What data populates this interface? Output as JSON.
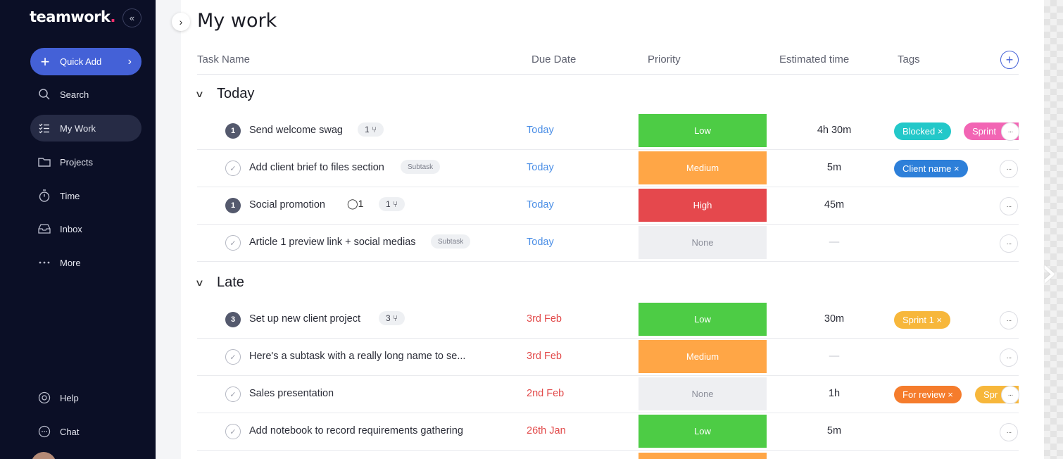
{
  "app": {
    "logo": "teamwork",
    "logo_dot": ".",
    "collapse_icon": "«"
  },
  "sidebar": {
    "quick_add": {
      "label": "Quick Add",
      "plus": "+",
      "arrow": "›"
    },
    "items": [
      {
        "label": "Search",
        "icon": "search-icon",
        "active": false
      },
      {
        "label": "My Work",
        "icon": "list-check-icon",
        "active": true
      },
      {
        "label": "Projects",
        "icon": "folder-icon",
        "active": false
      },
      {
        "label": "Time",
        "icon": "stopwatch-icon",
        "active": false
      },
      {
        "label": "Inbox",
        "icon": "inbox-icon",
        "active": false
      },
      {
        "label": "More",
        "icon": "more-dots-icon",
        "active": false
      }
    ],
    "bottom": [
      {
        "label": "Help",
        "icon": "help-icon"
      },
      {
        "label": "Chat",
        "icon": "chat-icon"
      }
    ]
  },
  "header": {
    "title": "My work",
    "expand_icon": "›"
  },
  "columns": {
    "task": "Task Name",
    "due": "Due Date",
    "priority": "Priority",
    "estimate": "Estimated time",
    "tags": "Tags"
  },
  "groups": [
    {
      "label": "Today",
      "chevron": "∨"
    },
    {
      "label": "Late",
      "chevron": "∨"
    }
  ],
  "rows": [
    {
      "status": "1",
      "name": "Send welcome swag",
      "chip": "1 ⑂",
      "due": "Today",
      "priority": "Low",
      "estimate": "4h 30m",
      "tags": [
        {
          "label": "Blocked ×",
          "color": "#23c8c9"
        },
        {
          "label": "Sprint",
          "color": "#f265b4"
        }
      ]
    },
    {
      "status": "✓",
      "name": "Add client brief to files section",
      "subtask": "Subtask",
      "due": "Today",
      "priority": "Medium",
      "estimate": "5m",
      "tags": [
        {
          "label": "Client name ×",
          "color": "#2d7fd9"
        }
      ]
    },
    {
      "status": "1",
      "name": "Social promotion",
      "comment": "◯1",
      "chip": "1 ⑂",
      "due": "Today",
      "priority": "High",
      "estimate": "45m",
      "tags": []
    },
    {
      "status": "✓",
      "name": "Article 1 preview link + social medias",
      "subtask": "Subtask",
      "due": "Today",
      "priority": "None",
      "estimate": "—",
      "tags": []
    },
    {
      "status": "3",
      "name": "Set up new client project",
      "chip": "3 ⑂",
      "due": "3rd Feb",
      "priority": "Low",
      "estimate": "30m",
      "tags": [
        {
          "label": "Sprint 1 ×",
          "color": "#f7b73b"
        }
      ]
    },
    {
      "status": "✓",
      "name": "Here's a subtask with a really long name to se...",
      "due": "3rd Feb",
      "priority": "Medium",
      "estimate": "—",
      "tags": []
    },
    {
      "status": "✓",
      "name": "Sales presentation",
      "due": "2nd Feb",
      "priority": "None",
      "estimate": "1h",
      "tags": [
        {
          "label": "For review ×",
          "color": "#f57c2c"
        },
        {
          "label": "Spr",
          "color": "#f7b73b"
        }
      ]
    },
    {
      "status": "✓",
      "name": "Add notebook to record requirements gathering",
      "due": "26th Jan",
      "priority": "Low",
      "estimate": "5m",
      "tags": []
    }
  ],
  "more_glyph": "···",
  "add_column_glyph": "+"
}
